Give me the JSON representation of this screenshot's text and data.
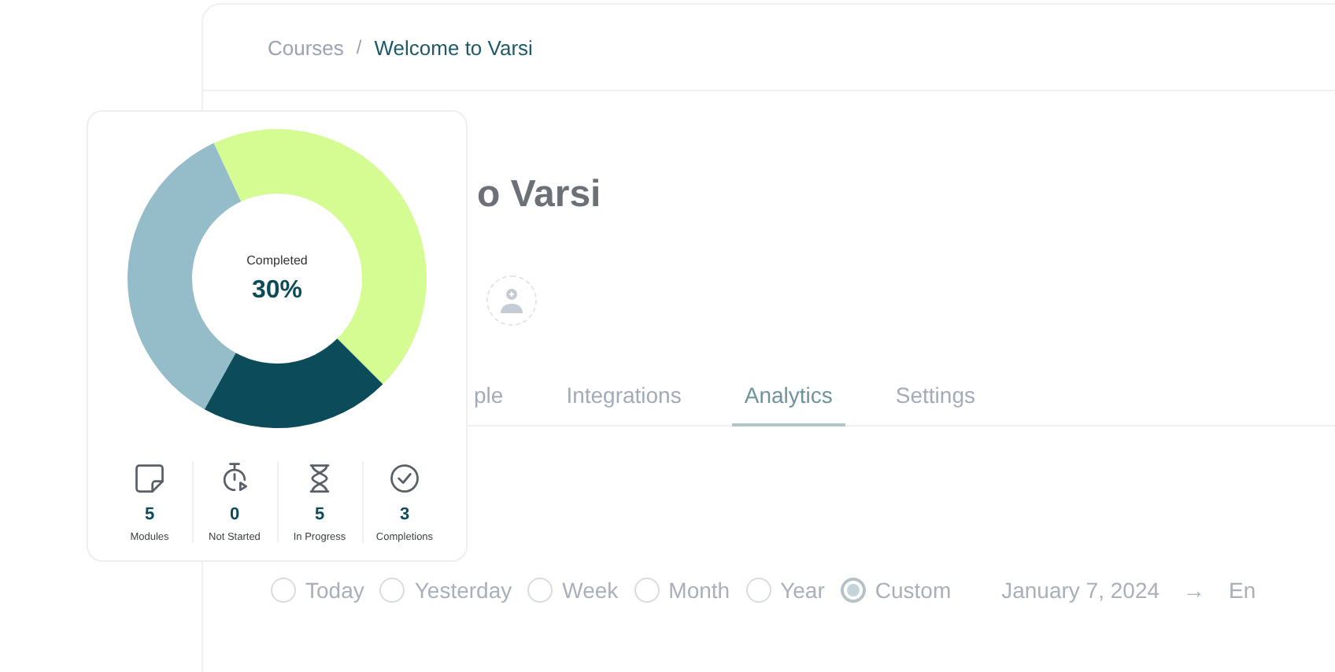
{
  "breadcrumb": [
    {
      "label": "Courses",
      "current": false
    },
    {
      "label": "Welcome to Varsi",
      "current": true
    }
  ],
  "breadcrumb_separator": "/",
  "title": "o Varsi",
  "tabs": [
    {
      "label": "ple",
      "selected": false
    },
    {
      "label": "Integrations",
      "selected": false
    },
    {
      "label": "Analytics",
      "selected": true
    },
    {
      "label": "Settings",
      "selected": false
    }
  ],
  "periods": [
    {
      "label": "Today",
      "selected": false
    },
    {
      "label": "Yesterday",
      "selected": false
    },
    {
      "label": "Week",
      "selected": false
    },
    {
      "label": "Month",
      "selected": false
    },
    {
      "label": "Year",
      "selected": false
    },
    {
      "label": "Custom",
      "selected": true
    }
  ],
  "date_start": "January 7, 2024",
  "date_arrow": "→",
  "date_end": "En",
  "summary": {
    "center_label": "Completed",
    "center_value": "30%",
    "stats": [
      {
        "kind": "modules",
        "value": "5",
        "label": "Modules"
      },
      {
        "kind": "not_started",
        "value": "0",
        "label": "Not Started"
      },
      {
        "kind": "in_progress",
        "value": "5",
        "label": "In Progress"
      },
      {
        "kind": "completions",
        "value": "3",
        "label": "Completions"
      }
    ]
  }
}
